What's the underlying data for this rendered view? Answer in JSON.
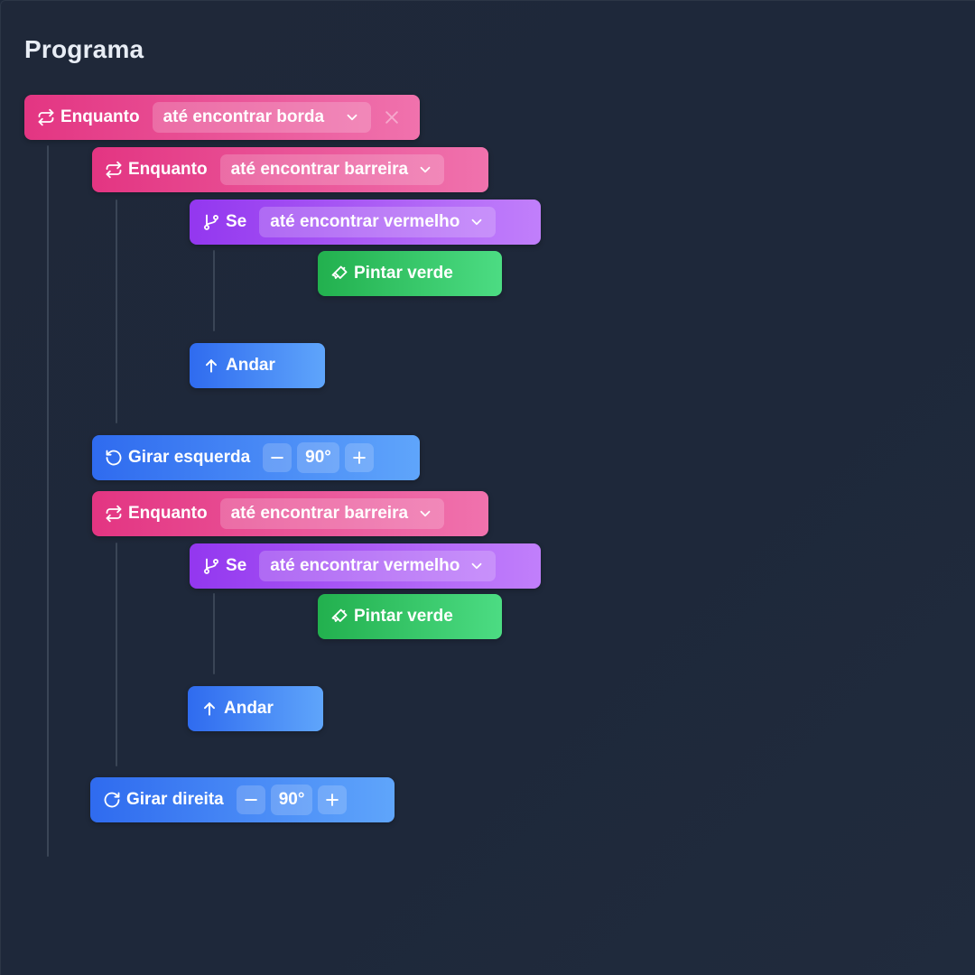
{
  "panel": {
    "title": "Programa"
  },
  "blocks": {
    "loop1": {
      "label": "Enquanto",
      "condition": "até encontrar borda",
      "icon": "repeat-icon"
    },
    "loop2": {
      "label": "Enquanto",
      "condition": "até encontrar barreira",
      "icon": "repeat-icon"
    },
    "if1": {
      "label": "Se",
      "condition": "até encontrar vermelho",
      "icon": "git-branch-icon"
    },
    "paint1": {
      "label": "Pintar verde",
      "icon": "paintbrush-icon"
    },
    "move1": {
      "label": "Andar",
      "icon": "arrow-up-icon"
    },
    "turn1": {
      "label": "Girar esquerda",
      "value": "90°",
      "icon": "rotate-ccw-icon"
    },
    "loop3": {
      "label": "Enquanto",
      "condition": "até encontrar barreira",
      "icon": "repeat-icon"
    },
    "if2": {
      "label": "Se",
      "condition": "até encontrar vermelho",
      "icon": "git-branch-icon"
    },
    "paint2": {
      "label": "Pintar verde",
      "icon": "paintbrush-icon"
    },
    "move2": {
      "label": "Andar",
      "icon": "arrow-up-icon"
    },
    "turn2": {
      "label": "Girar direita",
      "value": "90°",
      "icon": "rotate-cw-icon"
    }
  },
  "colors": {
    "background": "#1e2839",
    "loop": "#e33582",
    "condition": "#9337ef",
    "paint": "#22b04e",
    "move": "#2f6bef"
  }
}
